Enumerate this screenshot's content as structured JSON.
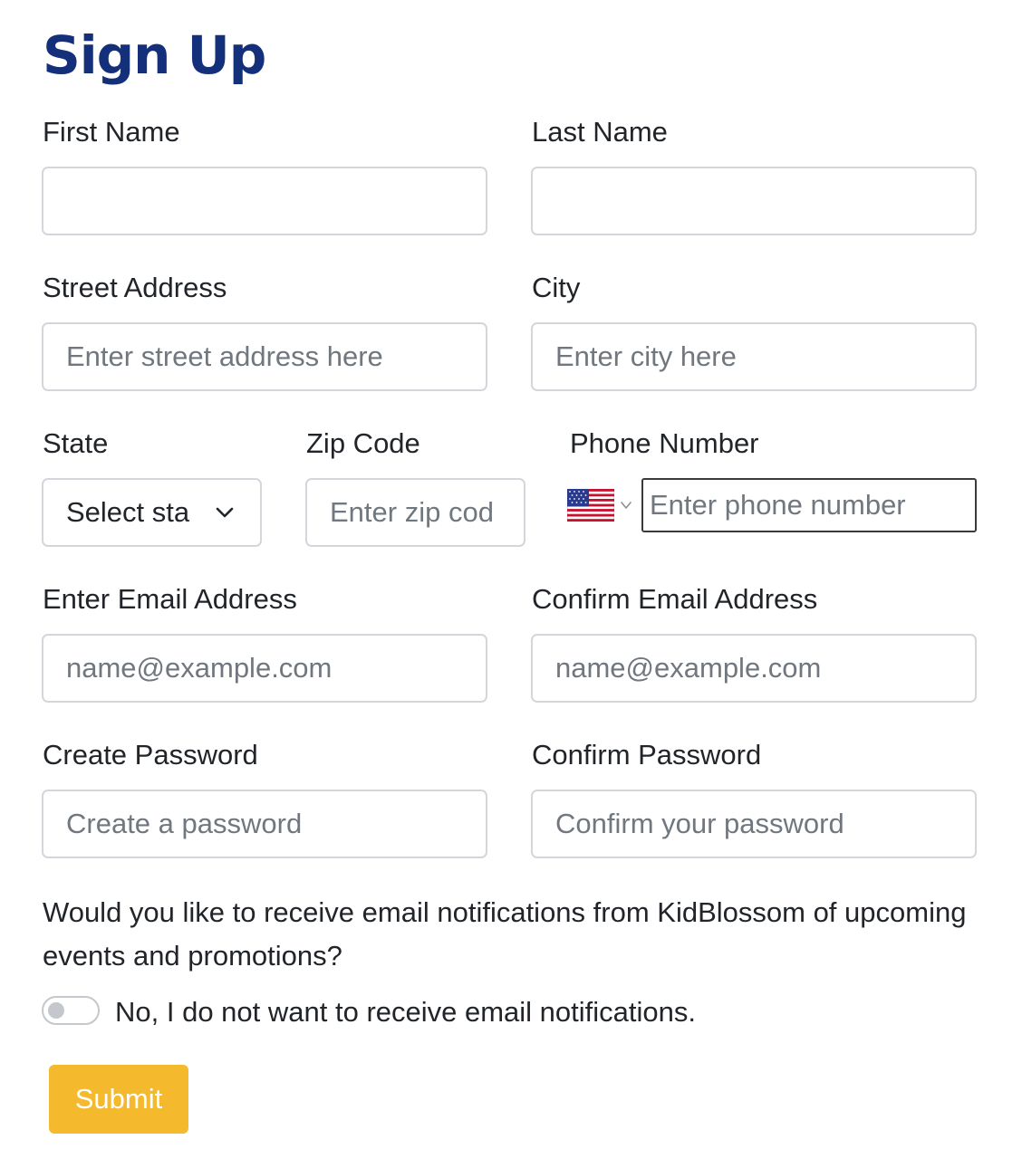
{
  "page": {
    "title": "Sign Up"
  },
  "fields": {
    "first_name": {
      "label": "First Name",
      "value": "",
      "placeholder": ""
    },
    "last_name": {
      "label": "Last Name",
      "value": "",
      "placeholder": ""
    },
    "street": {
      "label": "Street Address",
      "value": "",
      "placeholder": "Enter street address here"
    },
    "city": {
      "label": "City",
      "value": "",
      "placeholder": "Enter city here"
    },
    "state": {
      "label": "State",
      "selected": "Select sta"
    },
    "zip": {
      "label": "Zip Code",
      "value": "",
      "placeholder": "Enter zip cod"
    },
    "phone": {
      "label": "Phone Number",
      "value": "",
      "placeholder": "Enter phone number",
      "country_flag": "us-flag-icon"
    },
    "email": {
      "label": "Enter Email Address",
      "value": "",
      "placeholder": "name@example.com"
    },
    "confirm_email": {
      "label": "Confirm Email Address",
      "value": "",
      "placeholder": "name@example.com"
    },
    "password": {
      "label": "Create Password",
      "value": "",
      "placeholder": "Create a password"
    },
    "confirm_password": {
      "label": "Confirm Password",
      "value": "",
      "placeholder": "Confirm your password"
    }
  },
  "notifications": {
    "question": "Would you like to receive email notifications from KidBlossom of upcoming events and promotions?",
    "toggle_label": "No, I do not want to receive email notifications.",
    "enabled": false
  },
  "submit_label": "Submit",
  "colors": {
    "title": "#14307a",
    "submit_bg": "#f4b92d",
    "input_border": "#d3d6db",
    "placeholder": "#70777e"
  }
}
